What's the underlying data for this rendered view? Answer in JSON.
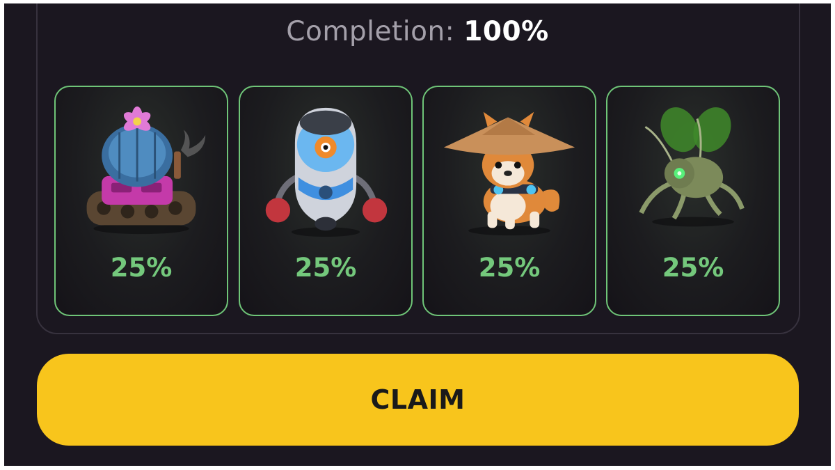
{
  "completion": {
    "label": "Completion:",
    "value": "100%"
  },
  "cards": [
    {
      "name": "cactus-tank",
      "icon": "cactus-tank-character",
      "percent_text": "25%"
    },
    {
      "name": "boxing-robot",
      "icon": "boxing-robot-character",
      "percent_text": "25%"
    },
    {
      "name": "shiba-dog",
      "icon": "shiba-dog-straw-hat-character",
      "percent_text": "25%"
    },
    {
      "name": "robot-bug",
      "icon": "robot-bug-character",
      "percent_text": "25%"
    }
  ],
  "claim_button": {
    "label": "CLAIM"
  },
  "colors": {
    "background": "#1b1720",
    "card_border": "#6fc578",
    "percent_text": "#74c87c",
    "button": "#f8c51c",
    "completion_label": "#a4a0aa"
  }
}
